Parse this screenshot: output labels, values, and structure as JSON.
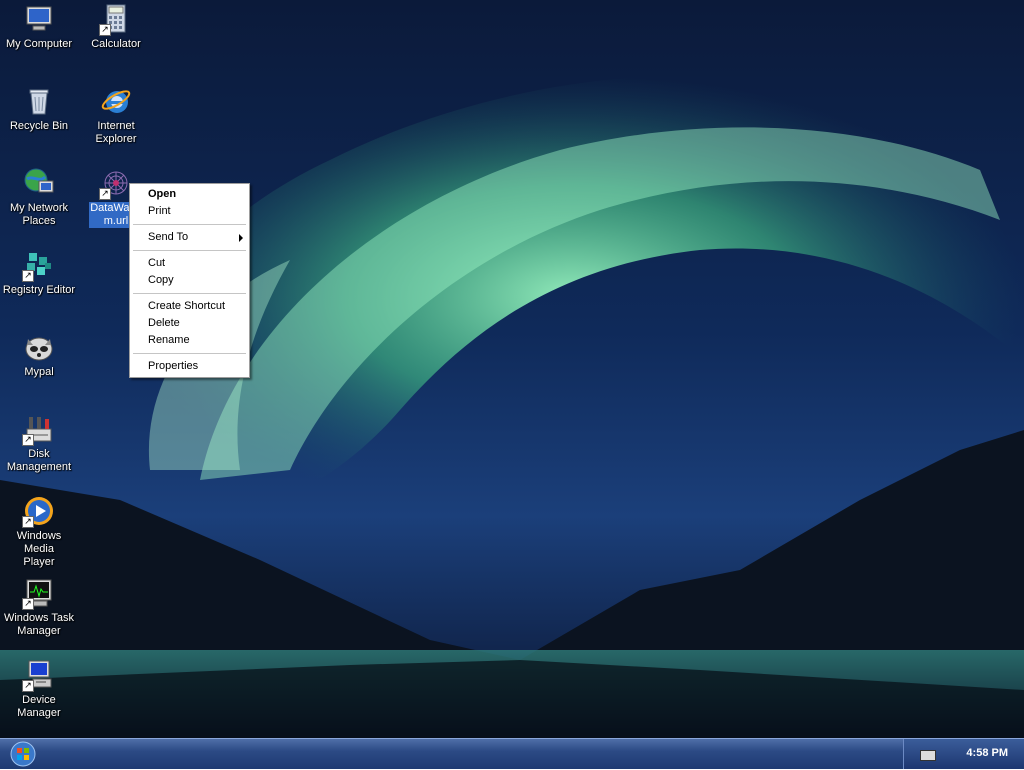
{
  "desktop": {
    "icons": [
      {
        "label": "My Computer",
        "icon": "my-computer-icon"
      },
      {
        "label": "Calculator",
        "icon": "calculator-icon"
      },
      {
        "label": "Recycle Bin",
        "icon": "recycle-bin-icon"
      },
      {
        "label": "Internet\nExplorer",
        "icon": "internet-explorer-icon"
      },
      {
        "label": "My Network\nPlaces",
        "icon": "network-places-icon"
      },
      {
        "label": "DataWago\nm.url",
        "icon": "url-shortcut-icon",
        "selected": true
      },
      {
        "label": "Registry Editor",
        "icon": "registry-editor-icon"
      },
      {
        "label": "Mypal",
        "icon": "mypal-browser-icon"
      },
      {
        "label": "Disk\nManagement",
        "icon": "disk-management-icon"
      },
      {
        "label": "Windows Media\nPlayer",
        "icon": "media-player-icon"
      },
      {
        "label": "Windows Task\nManager",
        "icon": "task-manager-icon"
      },
      {
        "label": "Device\nManager",
        "icon": "device-manager-icon"
      }
    ]
  },
  "context_menu": {
    "items": [
      "Open",
      "Print",
      "Send To",
      "Cut",
      "Copy",
      "Create Shortcut",
      "Delete",
      "Rename",
      "Properties"
    ]
  },
  "taskbar": {
    "start_icon": "windows-orb-icon",
    "tray_icon": "keyboard-icon",
    "clock": "4:58 PM"
  },
  "colors": {
    "selection": "#316ac5",
    "taskbar": "#2c4a85",
    "aurora": "#6fe0a6"
  }
}
